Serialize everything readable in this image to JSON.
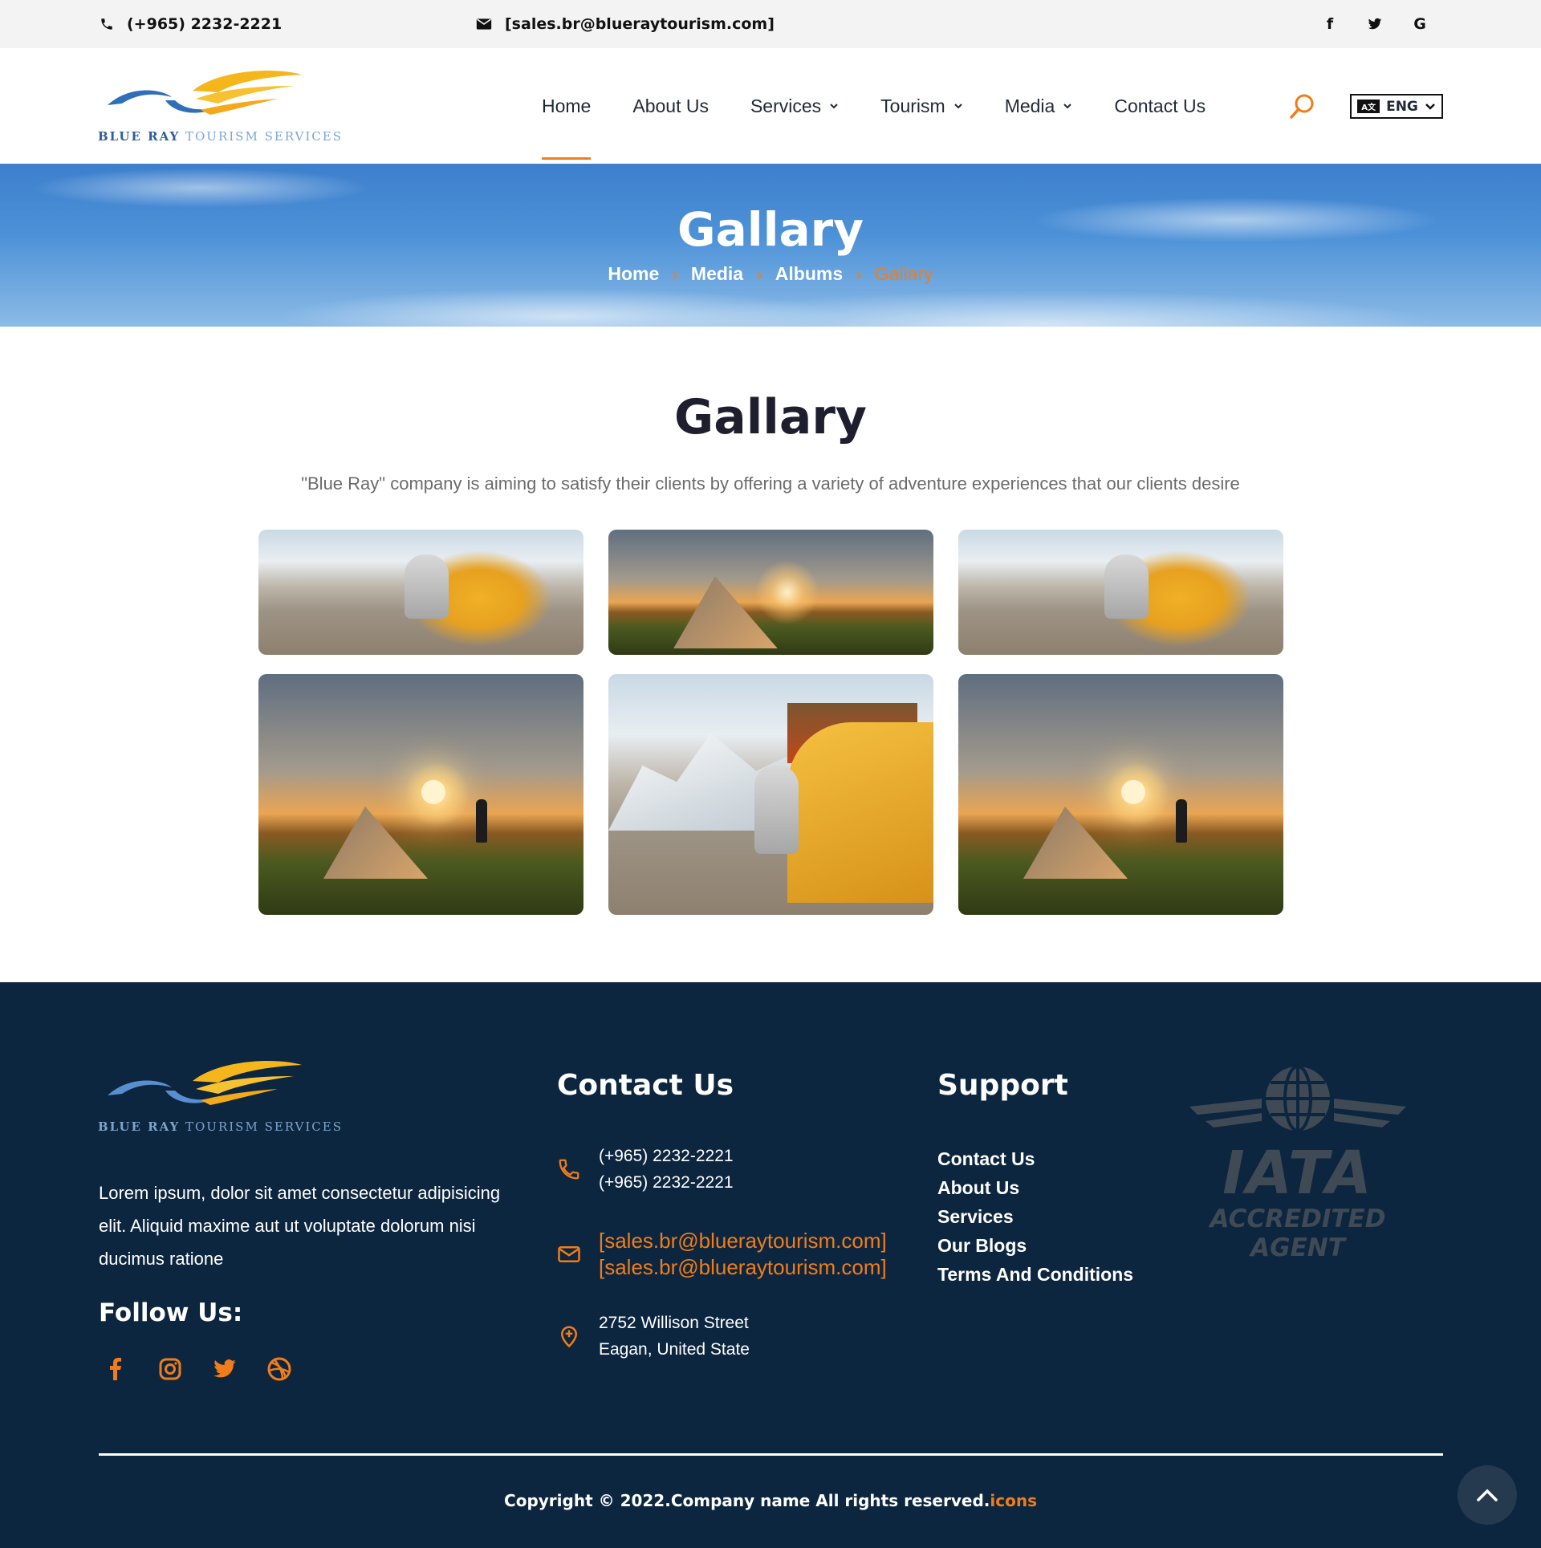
{
  "topbar": {
    "phone": "(+965) 2232-2221",
    "email": "[sales.br@blueraytourism.com]",
    "social": [
      "f",
      "t",
      "G"
    ]
  },
  "brand": {
    "logo_text_strong": "BLUE RAY",
    "logo_text_light": "TOURISM SERVICES"
  },
  "nav": {
    "items": [
      {
        "label": "Home",
        "active": true,
        "dropdown": false
      },
      {
        "label": "About Us",
        "dropdown": false
      },
      {
        "label": "Services",
        "dropdown": true
      },
      {
        "label": "Tourism",
        "dropdown": true
      },
      {
        "label": "Media",
        "dropdown": true
      },
      {
        "label": "Contact Us",
        "dropdown": false
      }
    ],
    "language": "ENG"
  },
  "hero": {
    "title": "Gallary",
    "breadcrumb": [
      "Home",
      "Media",
      "Albums",
      "Gallary"
    ]
  },
  "gallery": {
    "title": "Gallary",
    "subtitle": "\"Blue Ray\" company is aiming to satisfy their clients by offering a variety of adventure experiences that our clients desire",
    "photos": [
      "camping-chair",
      "tent-sunset",
      "camping-chair",
      "tent-sunset",
      "camping-chair",
      "tent-sunset"
    ]
  },
  "footer": {
    "about": "Lorem ipsum, dolor sit amet consectetur adipisicing elit. Aliquid maxime aut ut voluptate dolorum nisi ducimus ratione",
    "follow_label": "Follow Us:",
    "contact_title": "Contact Us",
    "phones": [
      "(+965) 2232-2221",
      "(+965) 2232-2221"
    ],
    "emails": [
      "[sales.br@blueraytourism.com]",
      "[sales.br@blueraytourism.com]"
    ],
    "address": [
      "2752 Willison Street",
      "Eagan, United State"
    ],
    "support_title": "Support",
    "support_links": [
      "Contact Us",
      "About Us",
      "Services",
      "Our Blogs",
      "Terms And Conditions"
    ],
    "badge_word": "IATA",
    "badge_sub": "ACCREDITED AGENT",
    "copyright": "Copyright © 2022.Company name All rights reserved.",
    "copyright_accent": "icons"
  },
  "colors": {
    "accent": "#f07d1a",
    "footer_bg": "#0d2640",
    "topbar_bg": "#f3f3f3"
  }
}
